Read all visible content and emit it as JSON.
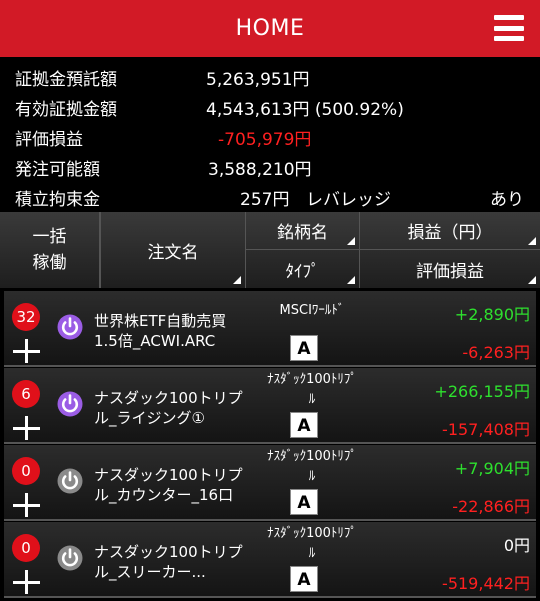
{
  "header": {
    "title": "HOME",
    "menu_icon": "hamburger-menu-icon",
    "bg_color": "#d21a26"
  },
  "summary": {
    "margin_deposit_label": "証拠金預託額",
    "margin_deposit_value": "5,263,951円",
    "effective_margin_label": "有効証拠金額",
    "effective_margin_value": "4,543,613円 (500.92%)",
    "valuation_pl_label": "評価損益",
    "valuation_pl_value": "-705,979円",
    "orderable_label": "発注可能額",
    "orderable_value": "3,588,210円",
    "reserve_label": "積立拘束金",
    "reserve_value": "257円",
    "leverage_label": "レバレッジ",
    "leverage_value": "あり"
  },
  "table_header": {
    "bulk_line1": "一括",
    "bulk_line2": "稼働",
    "order_name": "注文名",
    "symbol": "銘柄名",
    "type": "ﾀｲﾌﾟ",
    "pl": "損益（円）",
    "valuation": "評価損益"
  },
  "rows": [
    {
      "count": "32",
      "power_active": true,
      "order_line1": "世界株ETF自動売買",
      "order_line2": "1.5倍_ACWI.ARC",
      "symbol_line1": "MSCIﾜｰﾙﾄﾞ",
      "symbol_line2": "",
      "type": "A",
      "pl": "+2,890円",
      "pl_color": "green",
      "valuation": "-6,263円"
    },
    {
      "count": "6",
      "power_active": true,
      "order_line1": "ナスダック100トリプ",
      "order_line2": "ル_ライジング①",
      "symbol_line1": "ﾅｽﾀﾞｯｸ100ﾄﾘﾌﾟ",
      "symbol_line2": "ﾙ",
      "type": "A",
      "pl": "+266,155円",
      "pl_color": "green",
      "valuation": "-157,408円"
    },
    {
      "count": "0",
      "power_active": false,
      "order_line1": "ナスダック100トリプ",
      "order_line2": "ル_カウンター_16口",
      "symbol_line1": "ﾅｽﾀﾞｯｸ100ﾄﾘﾌﾟ",
      "symbol_line2": "ﾙ",
      "type": "A",
      "pl": "+7,904円",
      "pl_color": "green",
      "valuation": "-22,866円"
    },
    {
      "count": "0",
      "power_active": false,
      "order_line1": "ナスダック100トリプ",
      "order_line2": "ル_スリーカー...",
      "symbol_line1": "ﾅｽﾀﾞｯｸ100ﾄﾘﾌﾟ",
      "symbol_line2": "ﾙ",
      "type": "A",
      "pl": "0円",
      "pl_color": "white",
      "valuation": "-519,442円"
    }
  ],
  "colors": {
    "positive": "#2ee02e",
    "negative": "#ff2020",
    "badge": "#e0101a",
    "power_active": "#9b5de5",
    "power_inactive": "#8a8a8a"
  }
}
